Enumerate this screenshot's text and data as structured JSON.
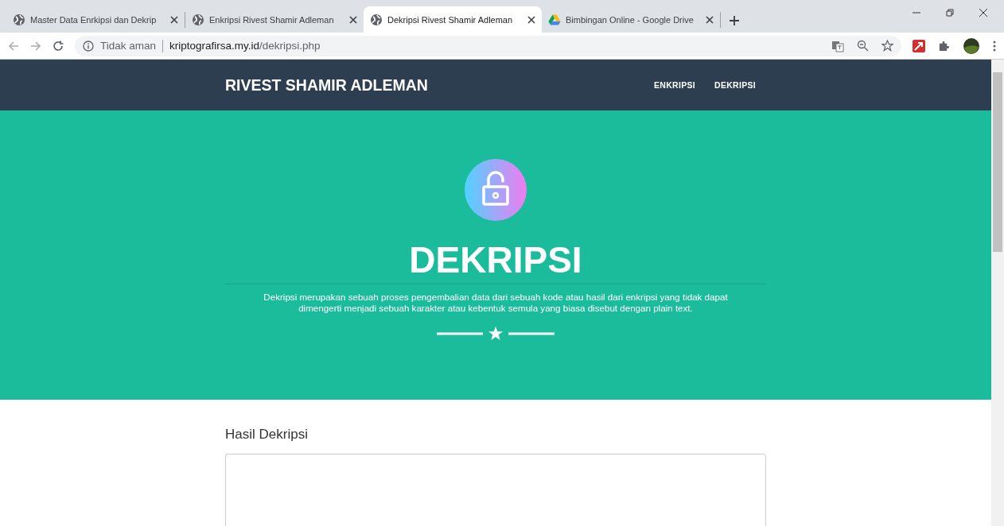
{
  "browser": {
    "tabs": [
      {
        "title": "Master Data Enrkipsi dan Dekrip",
        "kind": "globe",
        "selected": false
      },
      {
        "title": "Enkripsi Rivest Shamir Adleman",
        "kind": "globe",
        "selected": false
      },
      {
        "title": "Dekripsi Rivest Shamir Adleman",
        "kind": "globe",
        "selected": true
      },
      {
        "title": "Bimbingan Online - Google Drive",
        "kind": "drive",
        "selected": false
      }
    ],
    "address": {
      "security_label": "Tidak aman",
      "host": "kriptografirsa.my.id",
      "path": "/dekripsi.php"
    }
  },
  "site": {
    "brand": "RIVEST SHAMIR ADLEMAN",
    "nav": [
      {
        "label": "ENKRIPSI"
      },
      {
        "label": "DEKRIPSI"
      }
    ]
  },
  "hero": {
    "heading": "DEKRIPSI",
    "description": "Dekripsi merupakan sebuah proses pengembalian data dari sebuah kode atau hasil dari enkripsi yang tidak dapat dimengerti menjadi sebuah karakter atau kebentuk semula yang biasa disebut dengan plain text."
  },
  "result": {
    "label": "Hasil Dekripsi"
  }
}
